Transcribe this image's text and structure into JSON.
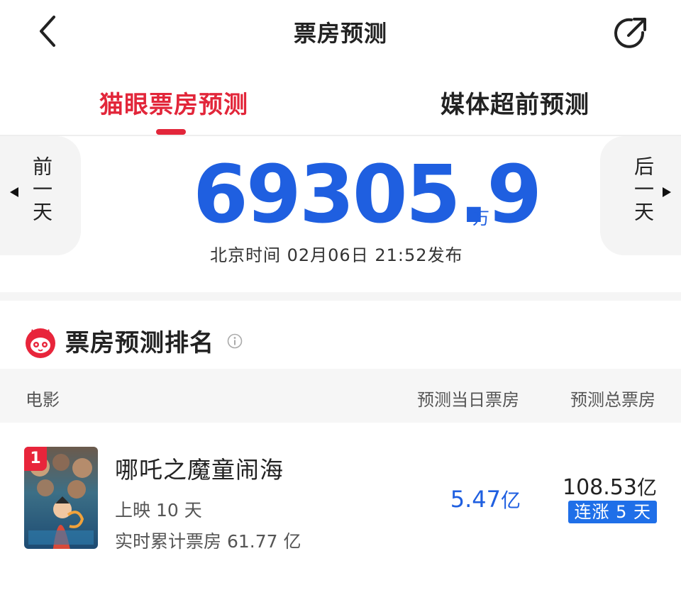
{
  "header": {
    "title": "票房预测",
    "back_icon": "chevron-left-icon",
    "share_icon": "share-icon"
  },
  "tabs": [
    {
      "label": "猫眼票房预测",
      "active": true
    },
    {
      "label": "媒体超前预测",
      "active": false
    }
  ],
  "prediction": {
    "prev_day_label": "前一天",
    "next_day_label": "后一天",
    "value": "69305.9",
    "unit": "万",
    "published": "北京时间 02月06日 21:52发布"
  },
  "ranking": {
    "title": "票房预测排名",
    "columns": {
      "movie": "电影",
      "day_forecast": "预测当日票房",
      "total_forecast": "预测总票房"
    },
    "rows": [
      {
        "rank": "1",
        "name": "哪吒之魔童闹海",
        "days_label": "上映 10 天",
        "cumulative_label": "实时累计票房 61.77 亿",
        "day_value": "5.47",
        "day_unit": "亿",
        "total_value": "108.53",
        "total_unit": "亿",
        "trend": "连涨 5 天"
      }
    ]
  },
  "colors": {
    "accent_red": "#e2263a",
    "accent_blue": "#1f5fe0",
    "badge_blue": "#1f6fe8"
  }
}
